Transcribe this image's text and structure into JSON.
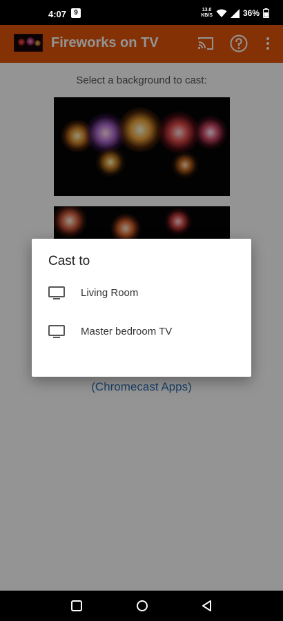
{
  "status_bar": {
    "time": "4:07",
    "notification": "9",
    "net_speed_value": "13.0",
    "net_speed_unit": "KB/S",
    "battery": "36%"
  },
  "app_bar": {
    "title": "Fireworks on TV",
    "cast_icon": "cast-icon",
    "help_icon": "help-icon",
    "more_icon": "more-vert-icon",
    "accent_color": "#e4550a"
  },
  "main": {
    "prompt": "Select a background to cast:",
    "backgrounds": [
      "fireworks-background-1",
      "fireworks-background-2"
    ],
    "chromecast_link": "(Chromecast Apps)"
  },
  "cast_dialog": {
    "title": "Cast to",
    "devices": [
      {
        "label": "Living Room",
        "icon": "tv-icon"
      },
      {
        "label": "Master bedroom TV",
        "icon": "tv-icon"
      }
    ]
  },
  "nav_bar": {
    "recents": "recents-icon",
    "home": "home-icon",
    "back": "back-icon"
  }
}
